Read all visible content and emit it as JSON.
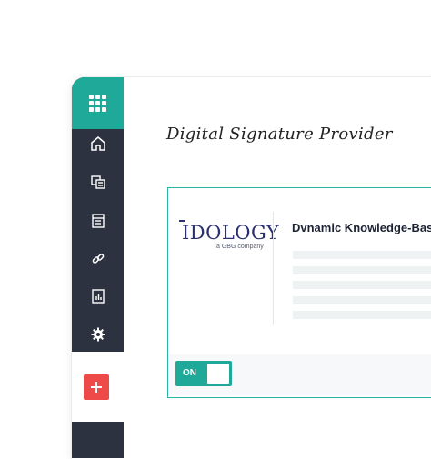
{
  "app": {
    "page_title": "Digital Signature Provider"
  },
  "sidebar": {
    "items": [
      {
        "name": "home",
        "icon": "home-icon"
      },
      {
        "name": "documents",
        "icon": "documents-icon"
      },
      {
        "name": "forms",
        "icon": "form-icon"
      },
      {
        "name": "links",
        "icon": "link-icon"
      },
      {
        "name": "reports",
        "icon": "report-icon"
      },
      {
        "name": "settings",
        "icon": "gear-icon"
      }
    ],
    "accent_color": "#1ea999",
    "bg_color": "#2d3240"
  },
  "provider_card": {
    "logo_text": "IDOLOGY",
    "logo_tagline": "a GBG company",
    "section_title": "Dvnamic Knowledge-Based",
    "toggle_label": "ON",
    "toggle_state": "on"
  },
  "add_button": {
    "icon": "plus-icon",
    "color": "#ee4a4a"
  }
}
